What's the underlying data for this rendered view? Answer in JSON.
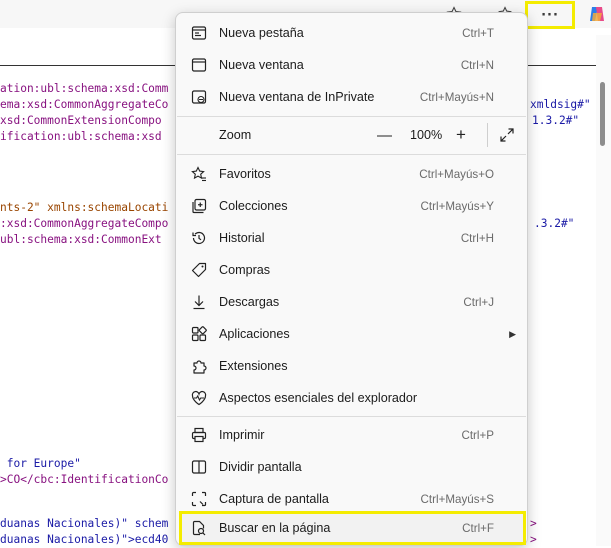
{
  "toolbar": {
    "favorite_icon": "star-icon",
    "favorites_icon": "star-list-icon",
    "more_label": "···",
    "copilot_icon": "copilot-icon"
  },
  "background_code": {
    "lines_left": [
      {
        "text": "ation:ubl:schema:xsd:Comm",
        "color": "purple"
      },
      {
        "text": "ema:xsd:CommonAggregateCo",
        "color": "purple"
      },
      {
        "text": "xsd:CommonExtensionCompo",
        "color": "purple"
      },
      {
        "text": "ification:ubl:schema:xsd",
        "color": "purple"
      },
      {
        "text": "nts-2\" xmlns:schemaLocati",
        "color": "mixed"
      },
      {
        "text": ":xsd:CommonAggregateCompo",
        "color": "purple"
      },
      {
        "text": "ubl:schema:xsd:CommonExt",
        "color": "purple"
      },
      {
        "text": " for Europe\"",
        "color": "navy"
      },
      {
        "text": ">CO</cbc:IdentificationCo",
        "color": "mixed"
      },
      {
        "text": "duanas Nacionales)\" schem",
        "color": "navy"
      },
      {
        "text": "duanas Nacionales)\">ecd40",
        "color": "navy"
      }
    ],
    "lines_right": [
      {
        "text": "xmldsig#\"",
        "color": "navy"
      },
      {
        "text": "1.3.2#\"",
        "color": "navy"
      },
      {
        "text": ".3.2#\"",
        "color": "navy"
      },
      {
        "text": ">",
        "color": "purple"
      },
      {
        "text": ">",
        "color": "purple"
      }
    ]
  },
  "menu": {
    "items": [
      {
        "label": "Nueva pestaña",
        "shortcut": "Ctrl+T",
        "icon": "new-tab-icon"
      },
      {
        "label": "Nueva ventana",
        "shortcut": "Ctrl+N",
        "icon": "new-window-icon"
      },
      {
        "label": "Nueva ventana de InPrivate",
        "shortcut": "Ctrl+Mayús+N",
        "icon": "inprivate-icon"
      },
      {
        "label": "Zoom",
        "shortcut": "",
        "icon": ""
      },
      {
        "label": "Favoritos",
        "shortcut": "Ctrl+Mayús+O",
        "icon": "favorites-icon"
      },
      {
        "label": "Colecciones",
        "shortcut": "Ctrl+Mayús+Y",
        "icon": "collections-icon"
      },
      {
        "label": "Historial",
        "shortcut": "Ctrl+H",
        "icon": "history-icon"
      },
      {
        "label": "Compras",
        "shortcut": "",
        "icon": "shopping-tag-icon"
      },
      {
        "label": "Descargas",
        "shortcut": "Ctrl+J",
        "icon": "download-icon"
      },
      {
        "label": "Aplicaciones",
        "shortcut": "",
        "icon": "apps-icon"
      },
      {
        "label": "Extensiones",
        "shortcut": "",
        "icon": "extensions-icon"
      },
      {
        "label": "Aspectos esenciales del explorador",
        "shortcut": "",
        "icon": "heart-pulse-icon"
      },
      {
        "label": "Imprimir",
        "shortcut": "Ctrl+P",
        "icon": "print-icon"
      },
      {
        "label": "Dividir pantalla",
        "shortcut": "",
        "icon": "split-screen-icon"
      },
      {
        "label": "Captura de pantalla",
        "shortcut": "Ctrl+Mayús+S",
        "icon": "screenshot-icon"
      },
      {
        "label": "Buscar en la página",
        "shortcut": "Ctrl+F",
        "icon": "find-in-page-icon"
      }
    ],
    "zoom": {
      "minus": "—",
      "value": "100%",
      "plus": "+",
      "fullscreen_icon": "fullscreen-icon"
    },
    "submenu_arrow": "▶"
  },
  "colors": {
    "highlight": "#f4ec00",
    "menu_bg": "#f9f9f9",
    "xml_element": "#881280",
    "xml_value": "#1a1aa6"
  }
}
